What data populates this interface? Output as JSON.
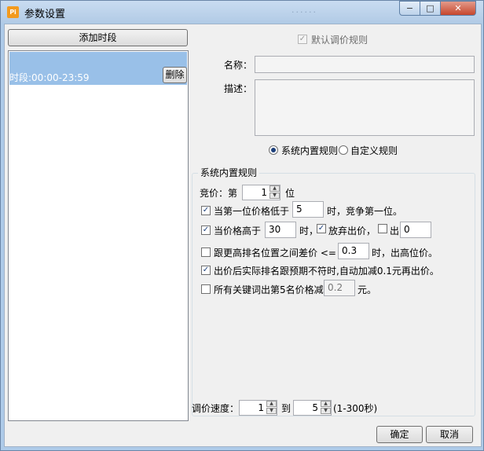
{
  "window": {
    "title": "参数设置",
    "app_icon": "Pi",
    "ghost_text": "······",
    "controls": {
      "min": "−",
      "max": "□",
      "close": "✕"
    }
  },
  "left": {
    "add_slot_label": "添加时段",
    "slots": [
      {
        "label": "时段:00:00-23:59",
        "delete_label": "删除"
      }
    ]
  },
  "right": {
    "default_rule": {
      "label": "默认调价规则",
      "checked": true
    },
    "name_label": "名称：",
    "name_value": "",
    "desc_label": "描述：",
    "desc_value": "",
    "rule_type": {
      "builtin_label": "系统内置规则",
      "custom_label": "自定义规则",
      "selected": "builtin"
    },
    "group_title": "系统内置规则",
    "bid": {
      "prefix": "竞价：第",
      "value": "1",
      "suffix": "位"
    },
    "rule1": {
      "label": "当第一位价格低于",
      "value": "5",
      "suffix": "时，竞争第一位。",
      "checked": true
    },
    "rule2": {
      "label": "当价格高于",
      "value": "30",
      "mid": "时，",
      "abandon_label": "放弃出价，",
      "abandon_checked": true,
      "out_label": "出",
      "out_checked": false,
      "out_value": "0",
      "checked": true
    },
    "rule3": {
      "label": "跟更高排名位置之间差价 <=",
      "value": "0.3",
      "suffix": "时，出高位价。",
      "checked": false
    },
    "rule4": {
      "label": "出价后实际排名跟预期不符时,自动加减0.1元再出价。",
      "checked": true
    },
    "rule5": {
      "label": "所有关键词出第5名价格减",
      "value": "0.2",
      "suffix": "元。",
      "checked": false
    },
    "speed": {
      "label": "调价速度：",
      "from": "1",
      "to_label": "到",
      "to": "5",
      "range": "(1-300秒)"
    },
    "ok_label": "确定",
    "cancel_label": "取消"
  }
}
